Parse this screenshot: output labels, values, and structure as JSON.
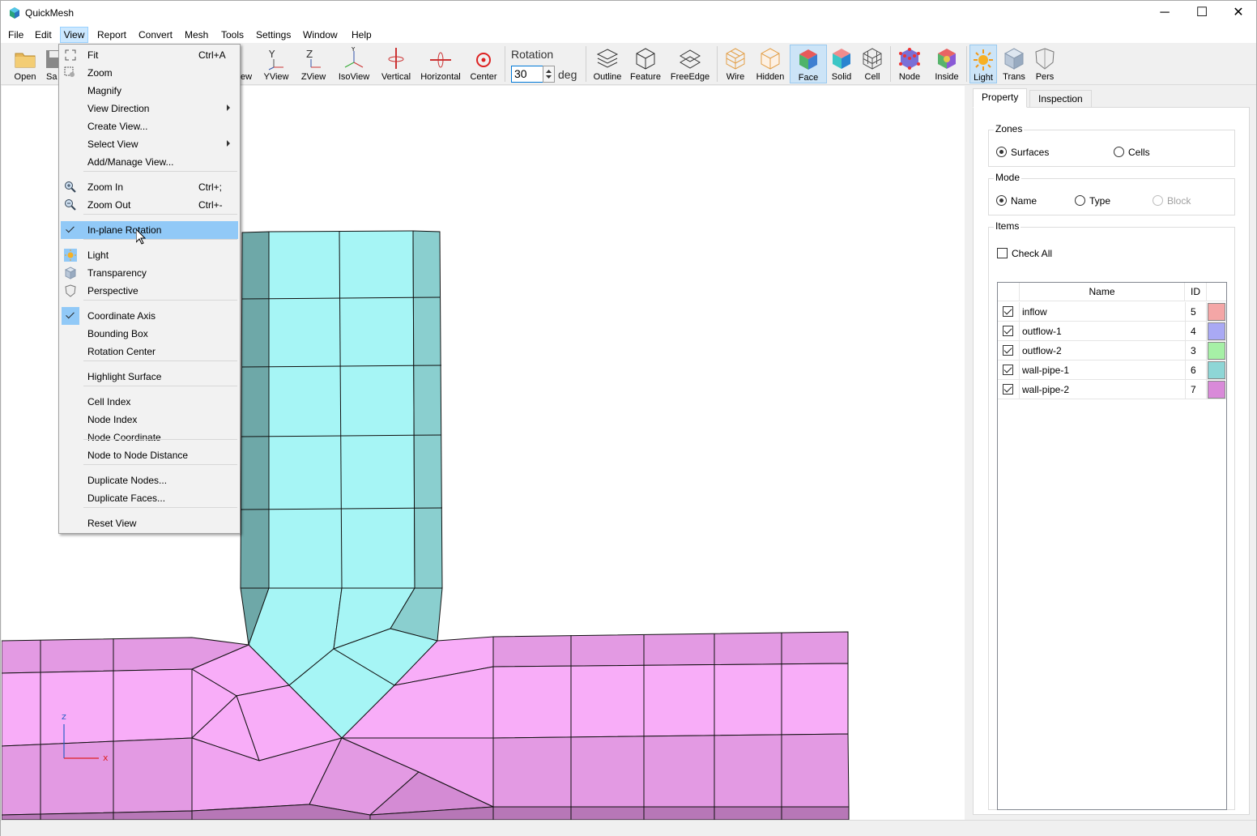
{
  "app": {
    "title": "QuickMesh"
  },
  "window_controls": {
    "minimize": "─",
    "maximize": "☐",
    "close": "✕"
  },
  "menubar": [
    "File",
    "Edit",
    "View",
    "Report",
    "Convert",
    "Mesh",
    "Tools",
    "Settings",
    "Window",
    "Help"
  ],
  "toolbar": {
    "buttons": [
      {
        "label": "Open",
        "icon": "folder-icon"
      },
      {
        "label": "Sa",
        "icon": "save-icon"
      },
      {
        "label": "ew",
        "icon": "xview-icon"
      },
      {
        "label": "YView",
        "icon": "yview-icon"
      },
      {
        "label": "ZView",
        "icon": "zview-icon"
      },
      {
        "label": "IsoView",
        "icon": "isoview-icon"
      },
      {
        "label": "Vertical",
        "icon": "vertical-rotation-icon"
      },
      {
        "label": "Horizontal",
        "icon": "horizontal-rotation-icon"
      },
      {
        "label": "Center",
        "icon": "center-icon"
      },
      {
        "label": "Outline",
        "icon": "outline-icon"
      },
      {
        "label": "Feature",
        "icon": "feature-icon"
      },
      {
        "label": "FreeEdge",
        "icon": "freeedge-icon"
      },
      {
        "label": "Wire",
        "icon": "wire-icon"
      },
      {
        "label": "Hidden",
        "icon": "hidden-icon"
      },
      {
        "label": "Face",
        "icon": "face-icon"
      },
      {
        "label": "Solid",
        "icon": "solid-icon"
      },
      {
        "label": "Cell",
        "icon": "cell-icon"
      },
      {
        "label": "Node",
        "icon": "node-icon"
      },
      {
        "label": "Inside",
        "icon": "inside-icon"
      },
      {
        "label": "Light",
        "icon": "light-icon"
      },
      {
        "label": "Trans",
        "icon": "transparency-icon"
      },
      {
        "label": "Pers",
        "icon": "perspective-icon"
      }
    ],
    "rotation": {
      "label": "Rotation",
      "value": "30",
      "unit": "deg"
    }
  },
  "view_menu": {
    "items": [
      {
        "label": "Fit",
        "shortcut": "Ctrl+A",
        "icon": "fit-icon"
      },
      {
        "label": "Zoom",
        "icon": "zoom-icon"
      },
      {
        "label": "Magnify"
      },
      {
        "label": "View Direction",
        "submenu": true
      },
      {
        "label": "Create View..."
      },
      {
        "label": "Select View",
        "submenu": true
      },
      {
        "label": "Add/Manage View..."
      },
      {
        "label": "Zoom In",
        "shortcut": "Ctrl+;",
        "icon": "zoom-in-icon"
      },
      {
        "label": "Zoom Out",
        "shortcut": "Ctrl+-",
        "icon": "zoom-out-icon"
      },
      {
        "label": "In-plane Rotation",
        "checked": true,
        "highlighted": true
      },
      {
        "label": "Light",
        "icon": "light-icon"
      },
      {
        "label": "Transparency",
        "icon": "transparency-icon"
      },
      {
        "label": "Perspective",
        "icon": "perspective-icon"
      },
      {
        "label": "Coordinate Axis",
        "checked": true
      },
      {
        "label": "Bounding Box"
      },
      {
        "label": "Rotation Center"
      },
      {
        "label": "Highlight Surface"
      },
      {
        "label": "Cell Index"
      },
      {
        "label": "Node Index"
      },
      {
        "label": "Node Coordinate"
      },
      {
        "label": "Node to Node Distance"
      },
      {
        "label": "Duplicate Nodes..."
      },
      {
        "label": "Duplicate Faces..."
      },
      {
        "label": "Reset View"
      }
    ]
  },
  "panel": {
    "tabs": [
      "Property",
      "Inspection"
    ],
    "zones": {
      "title": "Zones",
      "options": [
        "Surfaces",
        "Cells"
      ],
      "selected": "Surfaces"
    },
    "mode": {
      "title": "Mode",
      "options": [
        "Name",
        "Type",
        "Block"
      ],
      "selected": "Name",
      "disabled": [
        "Block"
      ]
    },
    "items": {
      "title": "Items",
      "check_all": "Check All",
      "columns": [
        "Name",
        "ID"
      ],
      "rows": [
        {
          "name": "inflow",
          "id": "5",
          "color": "#f4a6a6"
        },
        {
          "name": "outflow-1",
          "id": "4",
          "color": "#a9a9f4"
        },
        {
          "name": "outflow-2",
          "id": "3",
          "color": "#a6f0a6"
        },
        {
          "name": "wall-pipe-1",
          "id": "6",
          "color": "#8ed6d6"
        },
        {
          "name": "wall-pipe-2",
          "id": "7",
          "color": "#d98ad9"
        }
      ]
    }
  },
  "axis": {
    "z": "z",
    "x": "x"
  },
  "colors": {
    "pipe_light": "#a6f5f5",
    "pipe_dark": "#6ea8a8",
    "pipe_mid": "#8acfcf",
    "wall_pink": "#f8adf8",
    "wall_mid": "#e39ae3",
    "wall_dark": "#b777b7",
    "menu_highlight": "#91c9f7",
    "accent": "#0078d7"
  }
}
